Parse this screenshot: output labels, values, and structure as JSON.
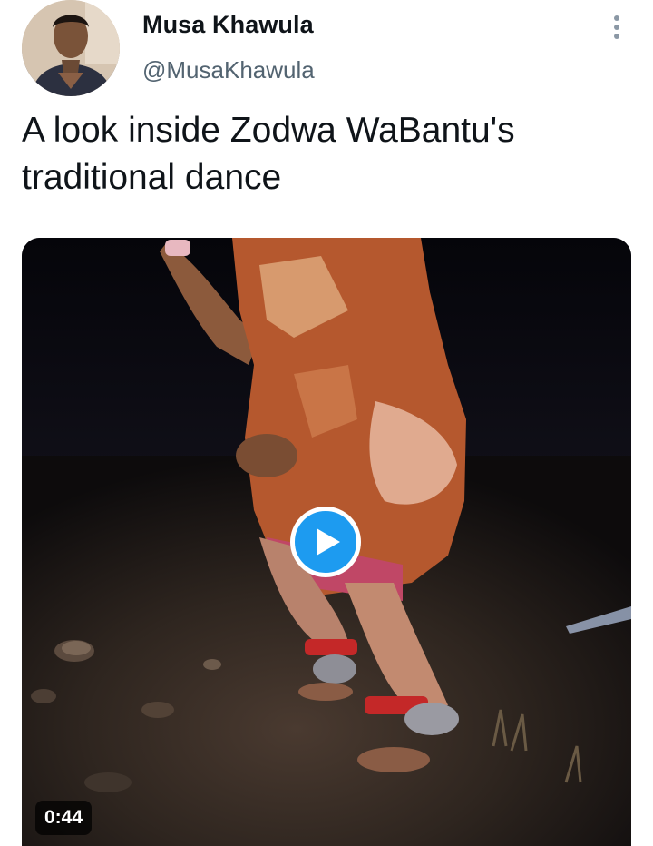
{
  "tweet": {
    "author": {
      "display_name": "Musa Khawula",
      "handle": "@MusaKhawula"
    },
    "text": "A look inside Zodwa WaBantu's traditional dance",
    "media": {
      "type": "video",
      "duration": "0:44"
    }
  },
  "icons": {
    "more": "more-vertical-icon",
    "play": "play-icon"
  },
  "colors": {
    "text_primary": "#0f1419",
    "text_secondary": "#536471",
    "accent": "#1d9bf0"
  }
}
